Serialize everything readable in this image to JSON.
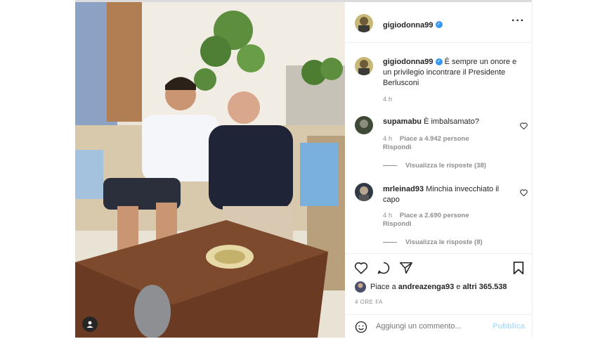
{
  "post": {
    "author": "gigiodonna99",
    "caption": "È sempre un onore e un privilegio incontrare il Presidente Berlusconi",
    "caption_time": "4 h"
  },
  "comments": [
    {
      "username": "supamabu",
      "text": "È imbalsamato?",
      "time": "4 h",
      "likes": "Piace a 4.942 persone",
      "reply": "Rispondi",
      "view_replies": "Visualizza le risposte (38)"
    },
    {
      "username": "mrleinad93",
      "text": "Minchia invecchiato il capo",
      "time": "4 h",
      "likes": "Piace a 2.690 persone",
      "reply": "Rispondi",
      "view_replies": "Visualizza le risposte (8)"
    }
  ],
  "likes_summary": {
    "prefix": "Piace a",
    "user": "andreazenga93",
    "suffix": "e",
    "others": "altri 365.538"
  },
  "timestamp": "4 ORE FA",
  "add_comment": {
    "placeholder": "Aggiungi un commento...",
    "publish": "Pubblica"
  },
  "icons": {
    "verified": "verified-badge-icon",
    "more": "more-options-icon",
    "like": "heart-icon",
    "comment": "comment-icon",
    "share": "send-icon",
    "save": "bookmark-icon",
    "emoji": "emoji-icon",
    "tag": "user-tag-icon"
  },
  "colors": {
    "verified": "#3897f0",
    "publish": "#b2dffc",
    "secondary_text": "#8e8e8e"
  }
}
